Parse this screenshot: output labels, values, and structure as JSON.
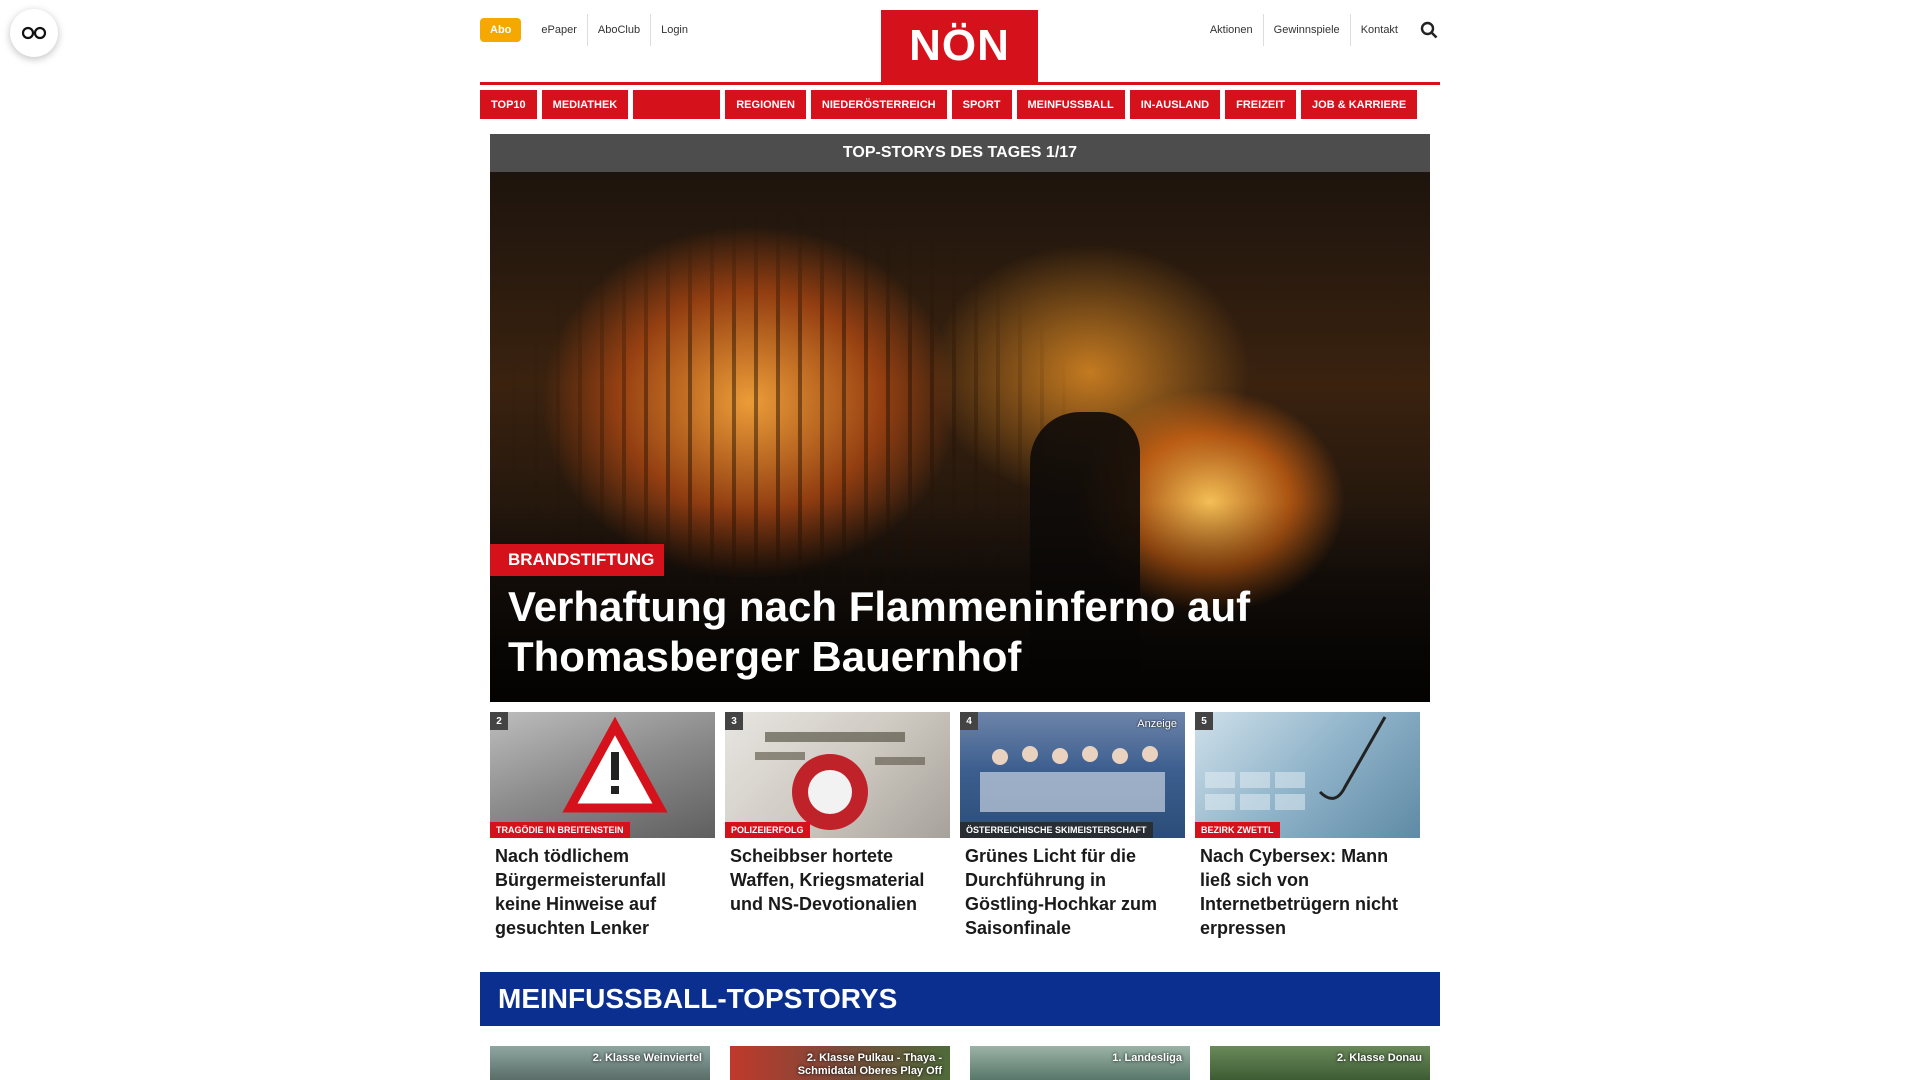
{
  "floating_button": {
    "icon": "glasses-icon"
  },
  "header": {
    "abo_label": "Abo",
    "left_links": [
      "ePaper",
      "AboClub",
      "Login"
    ],
    "logo_text": "NÖN",
    "right_links": [
      "Aktionen",
      "Gewinnspiele",
      "Kontakt"
    ],
    "search_icon": "search-icon"
  },
  "nav": {
    "items": [
      "TOP10",
      "MEDIATHEK",
      "",
      "REGIONEN",
      "NIEDERÖSTERREICH",
      "SPORT",
      "MEINFUSSBALL",
      "IN-AUSLAND",
      "FREIZEIT",
      "JOB & KARRIERE"
    ]
  },
  "hero": {
    "header": "TOP-STORYS DES TAGES 1/17",
    "kicker": "BRANDSTIFTUNG",
    "title": "Verhaftung nach Flammeninferno auf Thomasberger Bauernhof"
  },
  "stories": [
    {
      "num": "2",
      "tag": "TRAGÖDIE IN BREITENSTEIN",
      "title": "Nach tödlichem Bürgermeisterunfall keine Hinweise auf gesuchten Lenker",
      "ad": ""
    },
    {
      "num": "3",
      "tag": "POLIZEIERFOLG",
      "title": "Scheibbser hortete Waffen, Kriegsmaterial und NS-Devotionalien",
      "ad": ""
    },
    {
      "num": "4",
      "tag": "ÖSTERREICHISCHE SKIMEISTERSCHAFT",
      "title": "Grünes Licht für die Durchführung in Göstling-Hochkar zum Saisonfinale",
      "ad": "Anzeige"
    },
    {
      "num": "5",
      "tag": "BEZIRK ZWETTL",
      "title": "Nach Cybersex: Mann ließ sich von Internetbetrügern nicht erpressen",
      "ad": ""
    }
  ],
  "section": {
    "title": "MEINFUSSBALL-TOPSTORYS",
    "teasers": [
      "2. Klasse Weinviertel",
      "2. Klasse Pulkau - Thaya - Schmidatal Oberes Play Off",
      "1. Landesliga",
      "2. Klasse Donau"
    ]
  },
  "colors": {
    "brand_red": "#d5121b",
    "section_blue": "#0b2f8e",
    "abo_orange": "#f5a800",
    "hero_header_gray": "#4d4d4d"
  }
}
